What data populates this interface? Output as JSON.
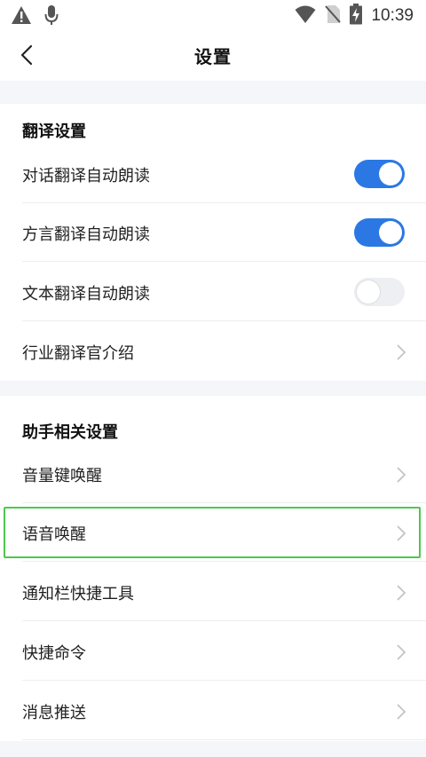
{
  "status_bar": {
    "time": "10:39",
    "icons": [
      "warning-icon",
      "mic-icon",
      "wifi-icon",
      "no-sim-icon",
      "battery-charging-icon"
    ]
  },
  "header": {
    "title": "设置",
    "back_icon": "chevron-left-icon"
  },
  "sections": [
    {
      "title": "翻译设置",
      "items": [
        {
          "label": "对话翻译自动朗读",
          "control": "toggle",
          "on": true
        },
        {
          "label": "方言翻译自动朗读",
          "control": "toggle",
          "on": true
        },
        {
          "label": "文本翻译自动朗读",
          "control": "toggle",
          "on": false
        },
        {
          "label": "行业翻译官介绍",
          "control": "chevron"
        }
      ]
    },
    {
      "title": "助手相关设置",
      "items": [
        {
          "label": "音量键唤醒",
          "control": "chevron"
        },
        {
          "label": "语音唤醒",
          "control": "chevron",
          "highlighted": true
        },
        {
          "label": "通知栏快捷工具",
          "control": "chevron"
        },
        {
          "label": "快捷命令",
          "control": "chevron"
        },
        {
          "label": "消息推送",
          "control": "chevron"
        }
      ]
    }
  ],
  "colors": {
    "toggle_on": "#2b78e4",
    "toggle_off": "#eeeff2",
    "section_gap": "#f5f6fa",
    "highlight": "#4cc94c"
  }
}
